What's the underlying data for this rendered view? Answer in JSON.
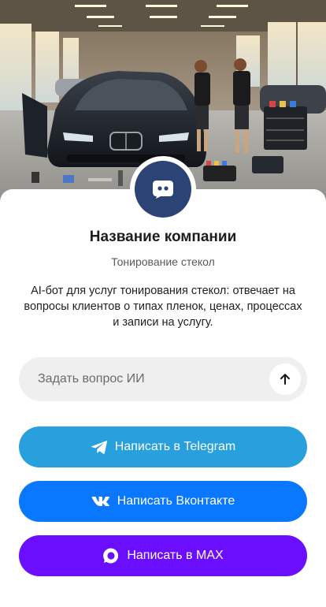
{
  "company": {
    "name": "Название компании",
    "category": "Тонирование стекол",
    "description": "AI-бот для услуг тонирования стекол: отвечает на вопросы клиентов о типах пленок, ценах, процессах и записи на услугу."
  },
  "hero": {
    "icon": "car-tinting-garage-photo"
  },
  "avatar": {
    "icon": "chat-bot-icon",
    "color": "#2b4375"
  },
  "ask": {
    "placeholder": "Задать вопрос ИИ",
    "button_icon": "arrow-up-icon"
  },
  "buttons": [
    {
      "label": "Написать в Telegram",
      "icon": "telegram-icon",
      "color": "#27a0dd"
    },
    {
      "label": "Написать Вконтакте",
      "icon": "vk-icon",
      "color": "#0a77ff"
    },
    {
      "label": "Написать в MAX",
      "icon": "max-icon",
      "color": "#6b0dff"
    }
  ]
}
